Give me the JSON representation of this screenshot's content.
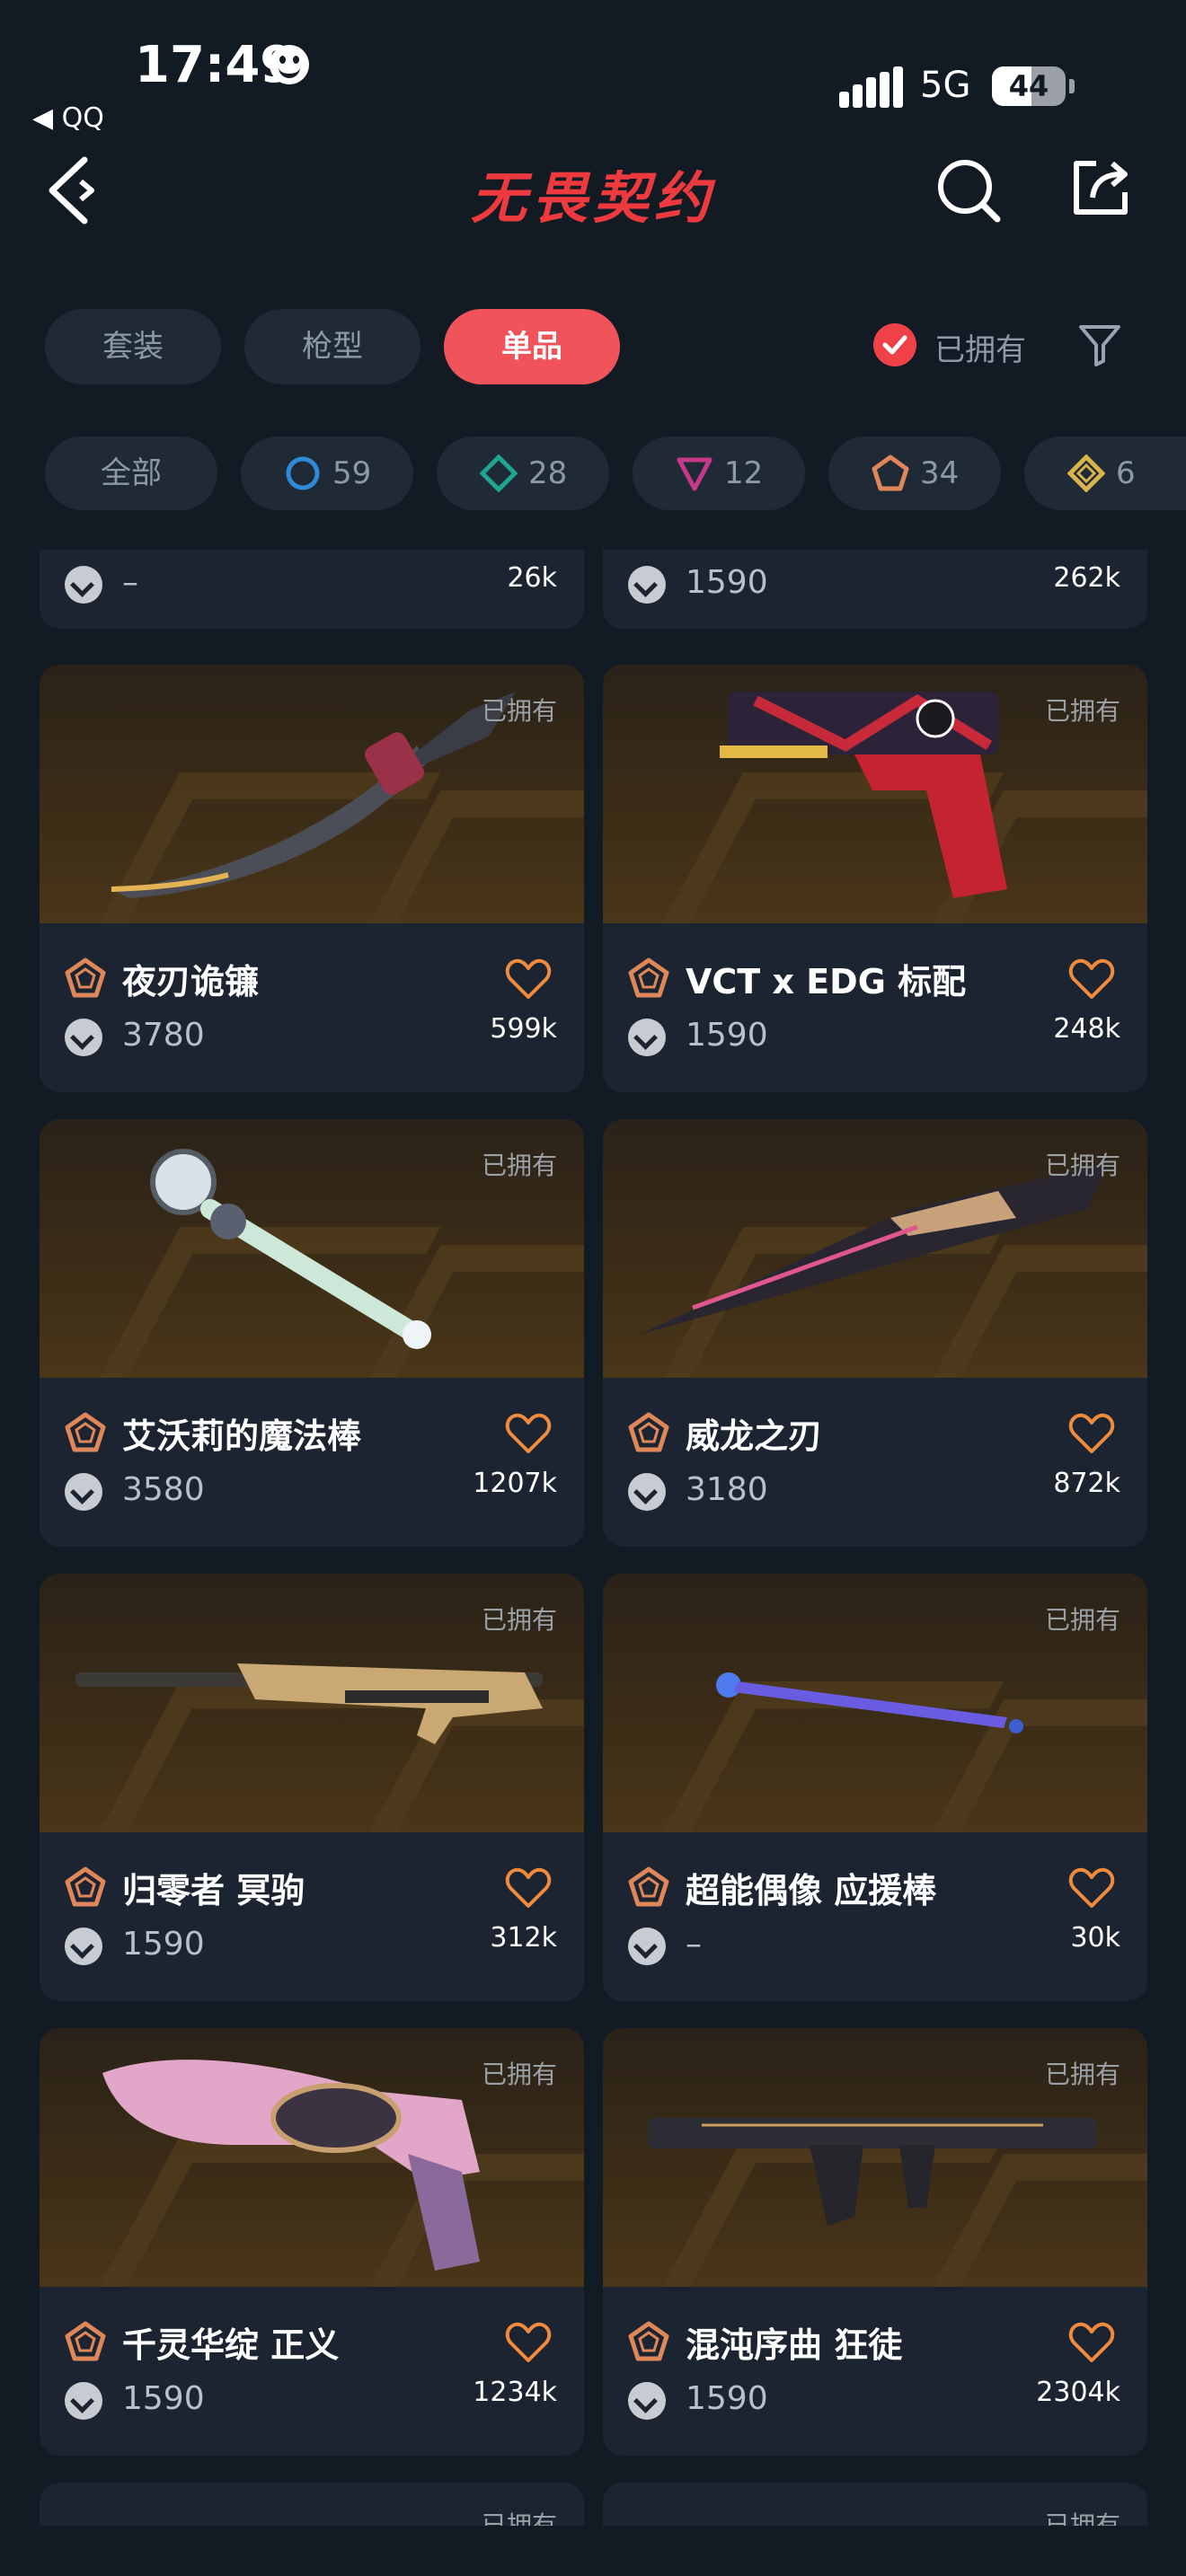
{
  "status_bar": {
    "time": "17:49",
    "back_app": "◀ QQ",
    "network": "5G",
    "battery": "44"
  },
  "header": {
    "title": "无畏契约"
  },
  "tabs": [
    {
      "label": "套装",
      "active": false
    },
    {
      "label": "枪型",
      "active": false
    },
    {
      "label": "单品",
      "active": true
    }
  ],
  "owned_filter_label": "已拥有",
  "chips": [
    {
      "label": "全部"
    },
    {
      "count": "59",
      "tier": "select",
      "color": "#2f8bd8"
    },
    {
      "count": "28",
      "tier": "deluxe",
      "color": "#1fa591"
    },
    {
      "count": "12",
      "tier": "premium",
      "color": "#c8388a"
    },
    {
      "count": "34",
      "tier": "exclusive",
      "color": "#e0875a"
    },
    {
      "count": "6",
      "tier": "ultra",
      "color": "#d9b34c"
    }
  ],
  "partial_top_row": [
    {
      "price": "–",
      "count": "26k"
    },
    {
      "price": "1590",
      "count": "262k"
    }
  ],
  "items": [
    {
      "name": "夜刃诡镰",
      "price": "3780",
      "count": "599k",
      "owned": "已拥有"
    },
    {
      "name": "VCT x EDG 标配",
      "price": "1590",
      "count": "248k",
      "owned": "已拥有"
    },
    {
      "name": "艾沃莉的魔法棒",
      "price": "3580",
      "count": "1207k",
      "owned": "已拥有"
    },
    {
      "name": "威龙之刃",
      "price": "3180",
      "count": "872k",
      "owned": "已拥有"
    },
    {
      "name": "归零者 冥驹",
      "price": "1590",
      "count": "312k",
      "owned": "已拥有"
    },
    {
      "name": "超能偶像 应援棒",
      "price": "–",
      "count": "30k",
      "owned": "已拥有"
    },
    {
      "name": "千灵华绽 正义",
      "price": "1590",
      "count": "1234k",
      "owned": "已拥有"
    },
    {
      "name": "混沌序曲 狂徒",
      "price": "1590",
      "count": "2304k",
      "owned": "已拥有"
    }
  ],
  "partial_bottom_row": [
    {
      "owned": "已拥有"
    },
    {
      "owned": "已拥有"
    }
  ]
}
